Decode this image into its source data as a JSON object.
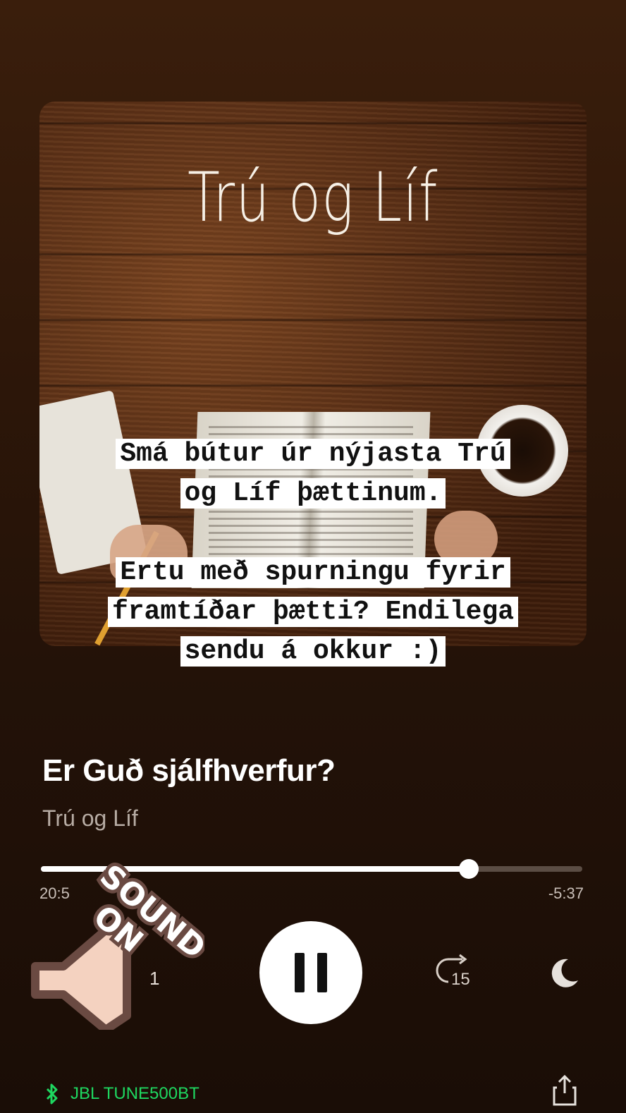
{
  "artwork": {
    "title": "Trú og Líf"
  },
  "caption": {
    "block1": [
      "Smá bútur úr nýjasta Trú",
      "og Líf þættinum."
    ],
    "block2": [
      "Ertu með spurningu fyrir",
      "framtíðar þætti? Endilega",
      "sendu á okkur :)"
    ]
  },
  "track": {
    "title": "Er Guð sjálfhverfur?",
    "artist": "Trú og Líf"
  },
  "playback": {
    "elapsed": "20:5",
    "remaining": "-5:37",
    "progress_fraction": 0.79,
    "back_label": "1",
    "forward_label": "15"
  },
  "sticker": {
    "text_line1": "SOUND",
    "text_line2": "ON"
  },
  "device": {
    "name": "JBL TUNE500BT"
  },
  "colors": {
    "accent_green": "#1ed760",
    "bg_top": "#3a1e0c",
    "bg_bottom": "#1a0d06"
  }
}
